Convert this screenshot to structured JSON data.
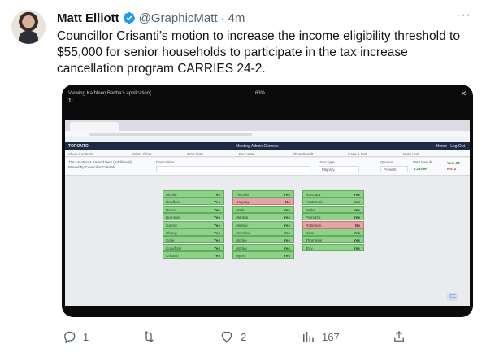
{
  "tweet": {
    "author_name": "Matt Elliott",
    "handle": "@GraphicMatt",
    "separator": "·",
    "time": "4m",
    "text": "Councillor Crisanti’s motion to increase the income eligibility threshold to $55,000 for senior households to participate in the tax increase cancellation program CARRIES 24-2.",
    "more_icon": "more-icon",
    "verified_color": "#1d9bf0"
  },
  "media": {
    "video_title": "Viewing Kathleen Bartha's application(…",
    "zoom": "63%",
    "close": "✕",
    "refresh": "↻",
    "app": {
      "logo": "TORONTO",
      "title": "Meeting Admin Console",
      "home": "Home",
      "logout": "Log Out"
    },
    "toolbar": [
      "Show Contexts",
      "Select Chair",
      "Start Vote",
      "End Vote",
      "Show Result",
      "Case & Exit",
      "Mute Vote"
    ],
    "motion": {
      "line1": "11A7 Motion 4 Amend Item (Additional)",
      "line2": "Moved by Councillor Crisanti",
      "description_label": "Description",
      "vote_type_label": "Vote Type",
      "vote_type_value": "Majority",
      "quorum_label": "Quorum",
      "quorum_value": "Present",
      "vote_result_label": "Vote Result",
      "vote_result_value": "Carried",
      "yes_count": "Yes: 24",
      "no_count": "No: 2"
    },
    "votes": [
      [
        {
          "name": "Ainslie",
          "vote": "Yes"
        },
        {
          "name": "Bradford",
          "vote": "Yes"
        },
        {
          "name": "Bravo",
          "vote": "Yes"
        },
        {
          "name": "Burnside",
          "vote": "Yes"
        },
        {
          "name": "Carroll",
          "vote": "Yes"
        },
        {
          "name": "Chang",
          "vote": "Yes"
        },
        {
          "name": "Colle",
          "vote": "Yes"
        },
        {
          "name": "Crawford",
          "vote": "Yes"
        },
        {
          "name": "Crisanti",
          "vote": "Yes"
        }
      ],
      [
        {
          "name": "Fletcher",
          "vote": "Yes"
        },
        {
          "name": "Holyday",
          "vote": "No"
        },
        {
          "name": "Malik",
          "vote": "Yes"
        },
        {
          "name": "Mantas",
          "vote": "Yes"
        },
        {
          "name": "Matlow",
          "vote": "Yes"
        },
        {
          "name": "McKelvie",
          "vote": "Yes"
        },
        {
          "name": "Morley",
          "vote": "Yes"
        },
        {
          "name": "Morley",
          "vote": "Yes"
        },
        {
          "name": "Myers",
          "vote": "Yes"
        }
      ],
      [
        {
          "name": "Nunziata",
          "vote": "Yes"
        },
        {
          "name": "Pasternak",
          "vote": "Yes"
        },
        {
          "name": "Perks",
          "vote": "Yes"
        },
        {
          "name": "Perruzza",
          "vote": "Yes"
        },
        {
          "name": "Robinson",
          "vote": "No"
        },
        {
          "name": "Saxe",
          "vote": "Yes"
        },
        {
          "name": "Thompson",
          "vote": "Yes"
        },
        {
          "name": "Tory",
          "vote": "Yes"
        }
      ]
    ],
    "cc_label": "CC"
  },
  "actions": {
    "reply_count": "1",
    "retweet_count": "",
    "like_count": "2",
    "views_count": "167"
  }
}
